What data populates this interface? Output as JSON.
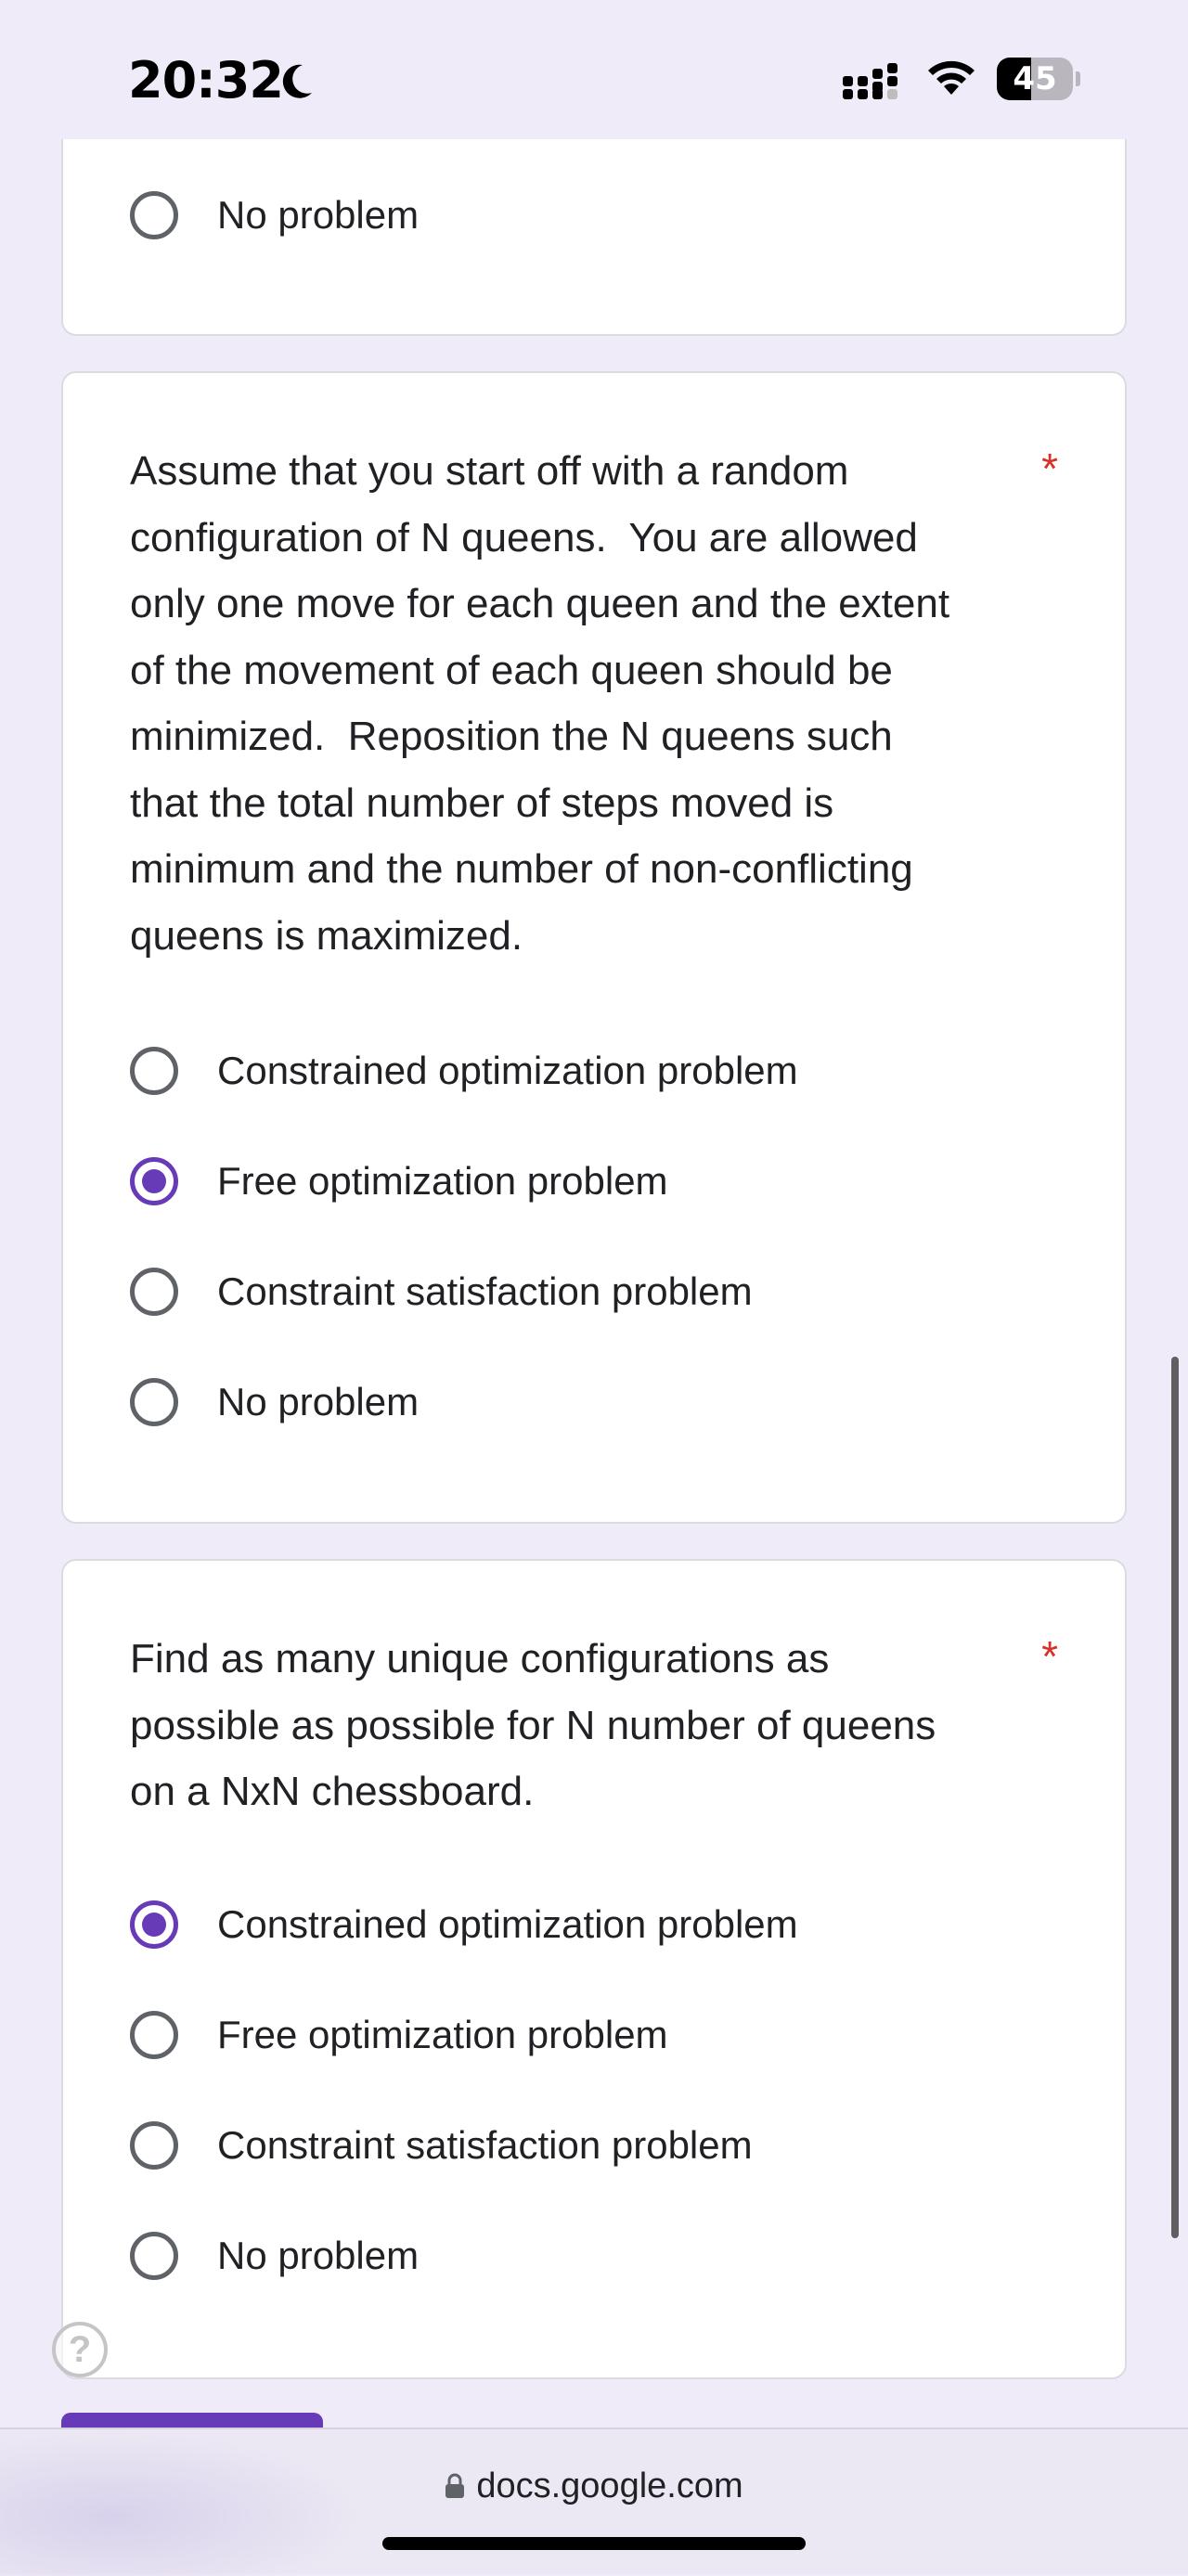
{
  "status_bar": {
    "time": "20:32",
    "battery": "45",
    "battery_level_percent": 45
  },
  "top_card": {
    "options": [
      {
        "label": "No problem",
        "selected": false
      }
    ]
  },
  "question1": {
    "text": "Assume that you start off with a random\nconfiguration of N queens.  You are allowed\nonly one move for each queen and the extent\nof the movement of each queen should be\nminimized.  Reposition the N queens such\nthat the total number of steps moved is\nminimum and the number of non-conflicting\nqueens is maximized.",
    "required_marker": "*",
    "options": [
      {
        "label": "Constrained optimization problem",
        "selected": false
      },
      {
        "label": "Free optimization problem",
        "selected": true
      },
      {
        "label": "Constraint satisfaction problem",
        "selected": false
      },
      {
        "label": "No problem",
        "selected": false
      }
    ]
  },
  "question2": {
    "text": "Find as many unique configurations as\npossible as possible for N number of queens\non a NxN chessboard.",
    "required_marker": "*",
    "options": [
      {
        "label": "Constrained optimization problem",
        "selected": true
      },
      {
        "label": "Free optimization problem",
        "selected": false
      },
      {
        "label": "Constraint satisfaction problem",
        "selected": false
      },
      {
        "label": "No problem",
        "selected": false
      }
    ]
  },
  "help": {
    "symbol": "?"
  },
  "browser": {
    "url": "docs.google.com"
  },
  "colors": {
    "accent": "#673ab7",
    "required": "#d93025",
    "page_bg": "#f0ebf8"
  }
}
